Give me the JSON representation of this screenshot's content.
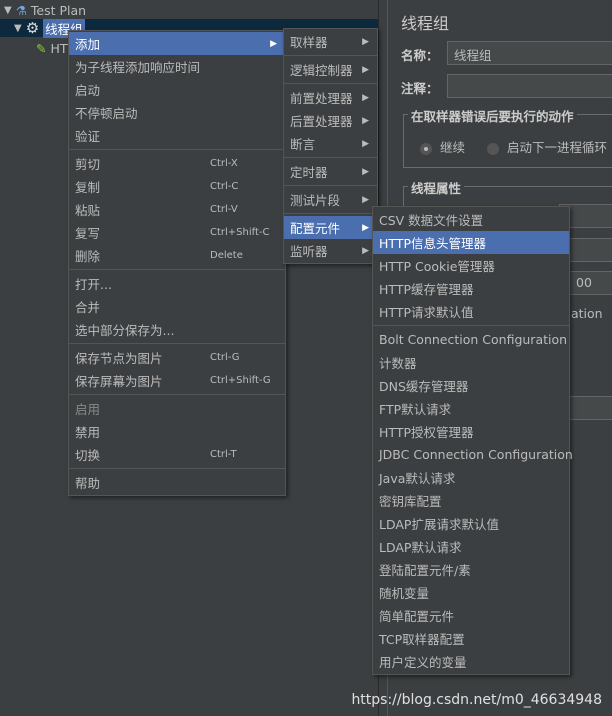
{
  "tree": {
    "root": "Test Plan",
    "thread_group": "线程组",
    "child": "HTTP"
  },
  "panel": {
    "title": "线程组",
    "name_label": "名称：",
    "name_value": "线程组",
    "comment_label": "注释：",
    "error_group": "在取样器错误后要执行的动作",
    "radio_continue": "继续",
    "radio_next_loop": "启动下一进程循环",
    "thread_props": "线程属性",
    "partial_value": "00",
    "partial_text": "ation"
  },
  "menu1": [
    {
      "label": "添加",
      "submenu": true,
      "highlight": true
    },
    {
      "label": "为子线程添加响应时间"
    },
    {
      "label": "启动"
    },
    {
      "label": "不停顿启动"
    },
    {
      "label": "验证"
    },
    {
      "sep": true
    },
    {
      "label": "剪切",
      "shortcut": "Ctrl-X"
    },
    {
      "label": "复制",
      "shortcut": "Ctrl-C"
    },
    {
      "label": "粘贴",
      "shortcut": "Ctrl-V"
    },
    {
      "label": "复写",
      "shortcut": "Ctrl+Shift-C"
    },
    {
      "label": "删除",
      "shortcut": "Delete"
    },
    {
      "sep": true
    },
    {
      "label": "打开..."
    },
    {
      "label": "合并"
    },
    {
      "label": "选中部分保存为..."
    },
    {
      "sep": true
    },
    {
      "label": "保存节点为图片",
      "shortcut": "Ctrl-G"
    },
    {
      "label": "保存屏幕为图片",
      "shortcut": "Ctrl+Shift-G"
    },
    {
      "sep": true
    },
    {
      "label": "启用",
      "disabled": true
    },
    {
      "label": "禁用"
    },
    {
      "label": "切换",
      "shortcut": "Ctrl-T"
    },
    {
      "sep": true
    },
    {
      "label": "帮助"
    }
  ],
  "menu2": [
    {
      "label": "取样器",
      "submenu": true
    },
    {
      "sep": true
    },
    {
      "label": "逻辑控制器",
      "submenu": true
    },
    {
      "sep": true
    },
    {
      "label": "前置处理器",
      "submenu": true
    },
    {
      "label": "后置处理器",
      "submenu": true
    },
    {
      "label": "断言",
      "submenu": true
    },
    {
      "sep": true
    },
    {
      "label": "定时器",
      "submenu": true
    },
    {
      "sep": true
    },
    {
      "label": "测试片段",
      "submenu": true
    },
    {
      "sep": true
    },
    {
      "label": "配置元件",
      "submenu": true,
      "highlight": true
    },
    {
      "label": "监听器",
      "submenu": true
    }
  ],
  "menu3": [
    {
      "label": "CSV 数据文件设置"
    },
    {
      "label": "HTTP信息头管理器",
      "highlight": true
    },
    {
      "label": "HTTP Cookie管理器"
    },
    {
      "label": "HTTP缓存管理器"
    },
    {
      "label": "HTTP请求默认值"
    },
    {
      "sep": true
    },
    {
      "label": "Bolt Connection Configuration"
    },
    {
      "label": "计数器"
    },
    {
      "label": "DNS缓存管理器"
    },
    {
      "label": "FTP默认请求"
    },
    {
      "label": "HTTP授权管理器"
    },
    {
      "label": "JDBC Connection Configuration"
    },
    {
      "label": "Java默认请求"
    },
    {
      "label": "密钥库配置"
    },
    {
      "label": "LDAP扩展请求默认值"
    },
    {
      "label": "LDAP默认请求"
    },
    {
      "label": "登陆配置元件/素"
    },
    {
      "label": "随机变量"
    },
    {
      "label": "简单配置元件"
    },
    {
      "label": "TCP取样器配置"
    },
    {
      "label": "用户定义的变量"
    }
  ],
  "watermark": "https://blog.csdn.net/m0_46634948"
}
